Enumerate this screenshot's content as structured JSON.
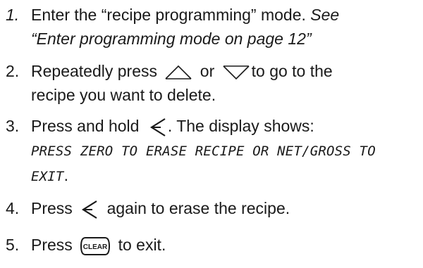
{
  "steps": [
    {
      "number": "1.",
      "text": "Enter the “recipe programming” mode.",
      "reference_part1": "See",
      "reference_part2": "“Enter programming mode on page 12”"
    },
    {
      "number": "2.",
      "text_before": "Repeatedly press",
      "text_middle": "or",
      "text_after": "to go to the",
      "text_line2": "recipe you want to delete."
    },
    {
      "number": "3.",
      "text_before": "Press and hold",
      "text_after": ". The display shows:",
      "display_line1": "PRESS ZERO TO ERASE RECIPE OR NET/GROSS TO",
      "display_line2": "EXIT",
      "display_end": "."
    },
    {
      "number": "4.",
      "text_before": "Press",
      "text_after": "again to erase the recipe."
    },
    {
      "number": "5.",
      "text_before": "Press",
      "key_label": "CLEAR",
      "text_after": "to exit."
    }
  ],
  "icons": {
    "up": "up-arrow-key-icon",
    "down": "down-arrow-key-icon",
    "back": "back-arrow-key-icon",
    "clear": "clear-key-icon"
  }
}
